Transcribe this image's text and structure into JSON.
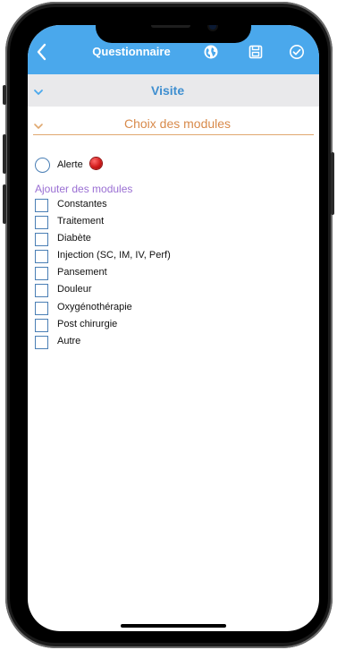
{
  "header": {
    "title": "Questionnaire",
    "back_icon": "chevron-left-icon",
    "icons": [
      "globe-icon",
      "save-icon",
      "check-circle-icon"
    ],
    "color": "#4aa8ec"
  },
  "visite": {
    "label": "Visite",
    "color": "#3f8fd0"
  },
  "modules_section": {
    "label": "Choix des modules",
    "color": "#d88a4b"
  },
  "alerte": {
    "label": "Alerte",
    "indicator_color": "#d11a1a"
  },
  "add_modules": {
    "label": "Ajouter des modules",
    "color": "#9a6fd3",
    "items": [
      {
        "label": "Constantes"
      },
      {
        "label": "Traitement"
      },
      {
        "label": "Diabète"
      },
      {
        "label": "Injection (SC, IM, IV, Perf)"
      },
      {
        "label": "Pansement"
      },
      {
        "label": "Douleur"
      },
      {
        "label": "Oxygénothérapie"
      },
      {
        "label": "Post chirurgie"
      },
      {
        "label": "Autre"
      }
    ]
  }
}
